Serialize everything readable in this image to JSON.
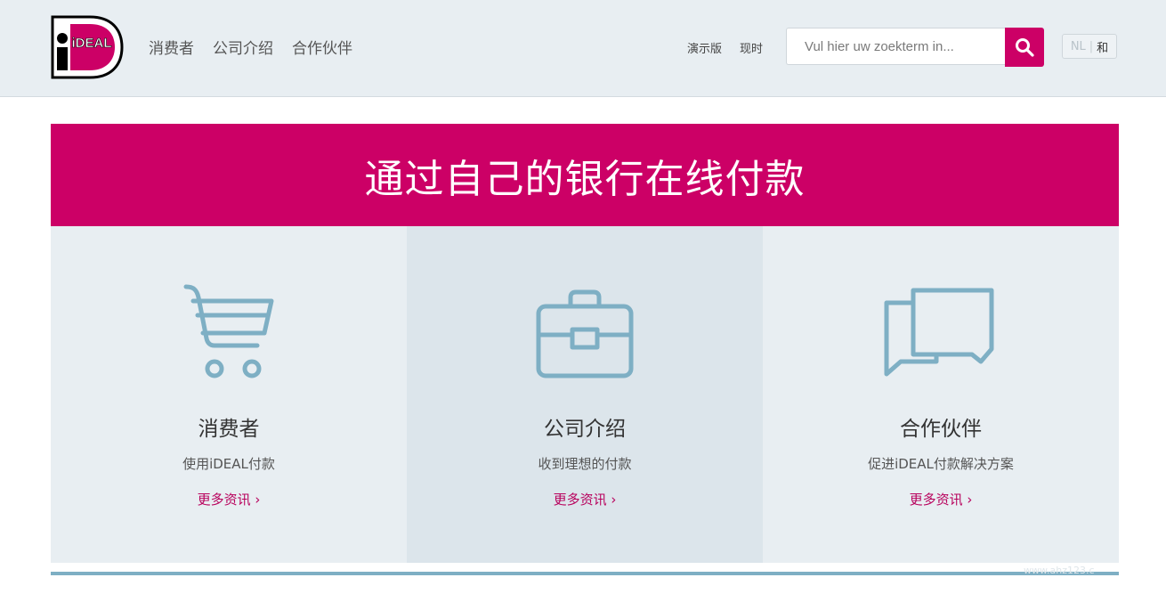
{
  "header": {
    "logo_text": "iDEAL",
    "nav": [
      {
        "label": "消费者"
      },
      {
        "label": "公司介绍"
      },
      {
        "label": "合作伙伴"
      }
    ],
    "top_links": [
      {
        "label": "演示版"
      },
      {
        "label": "现时"
      }
    ],
    "search": {
      "placeholder": "Vul hier uw zoekterm in..."
    },
    "lang": {
      "nl": "NL",
      "separator": "|",
      "active": "和"
    }
  },
  "hero": {
    "title": "通过自己的银行在线付款"
  },
  "cards": [
    {
      "icon": "shopping-cart-icon",
      "title": "消费者",
      "desc": "使用iDEAL付款",
      "link": "更多资讯 ›"
    },
    {
      "icon": "briefcase-icon",
      "title": "公司介绍",
      "desc": "收到理想的付款",
      "link": "更多资讯 ›"
    },
    {
      "icon": "chat-bubbles-icon",
      "title": "合作伙伴",
      "desc": "促进iDEAL付款解决方案",
      "link": "更多资讯 ›"
    }
  ],
  "watermark": "www.ahz123.c",
  "colors": {
    "brand": "#cc0066",
    "icon": "#7eafc4",
    "panel": "#e8eef2"
  }
}
